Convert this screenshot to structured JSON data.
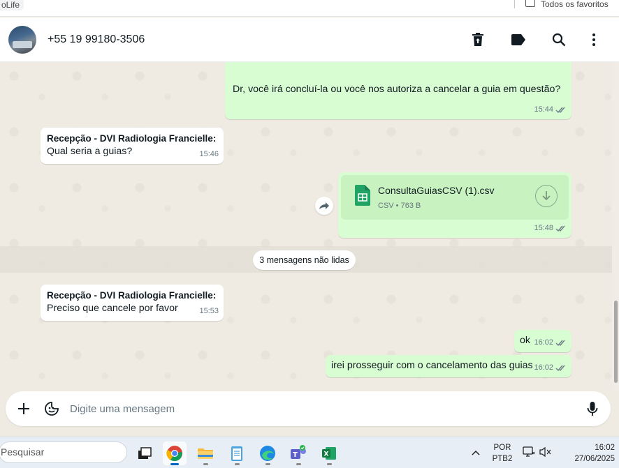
{
  "browser": {
    "tab_stub": "oLife",
    "favorites_label": "Todos os favoritos"
  },
  "header": {
    "contact": "+55 19 99180-3506"
  },
  "messages": {
    "m1": {
      "text": "Dr, você irá concluí-la ou você nos autoriza a cancelar a guia em questão?",
      "time": "15:44"
    },
    "m2": {
      "sender": "Recepção - DVI Radiologia Francielle:",
      "text": "Qual seria a guias?",
      "time": "15:46"
    },
    "m3": {
      "file_name": "ConsultaGuiasCSV (1).csv",
      "file_info": "CSV • 763 B",
      "time": "15:48"
    },
    "unread": "3 mensagens não lidas",
    "m4": {
      "sender": "Recepção - DVI Radiologia Francielle:",
      "text": "Preciso que cancele por favor",
      "time": "15:53"
    },
    "m5": {
      "text": "ok",
      "time": "16:02"
    },
    "m6": {
      "text": "irei prosseguir com o cancelamento das guias",
      "time": "16:02"
    }
  },
  "composer": {
    "placeholder": "Digite uma mensagem"
  },
  "taskbar": {
    "search": "Pesquisar",
    "lang_top": "POR",
    "lang_bottom": "PTB2",
    "time": "16:02",
    "date": "27/06/2025"
  },
  "colors": {
    "outgoing_bubble": "#d9fdd3",
    "incoming_bubble": "#ffffff",
    "chat_background": "#efeae2",
    "tick_blue": "#53bdeb"
  }
}
